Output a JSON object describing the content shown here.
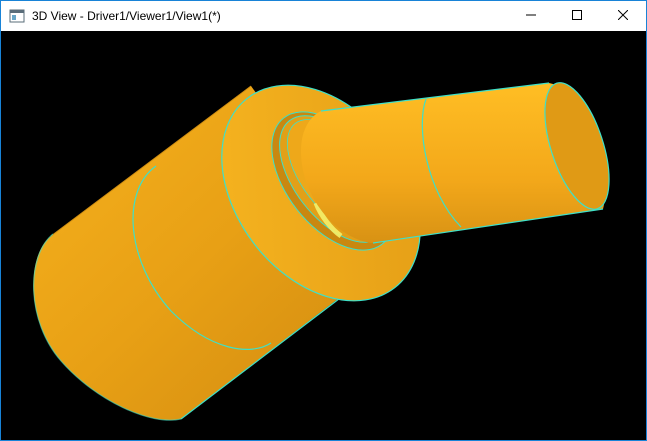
{
  "window": {
    "title": "3D View - Driver1/Viewer1/View1(*)",
    "icons": {
      "app": "3d-view-app-icon",
      "minimize": "minimize-icon",
      "maximize": "maximize-icon",
      "close": "close-icon"
    }
  },
  "viewport": {
    "background_color": "#000000",
    "shape_color": "#f0a81a",
    "edge_color": "#3fe0c8",
    "highlight_color": "#f4f06a"
  }
}
